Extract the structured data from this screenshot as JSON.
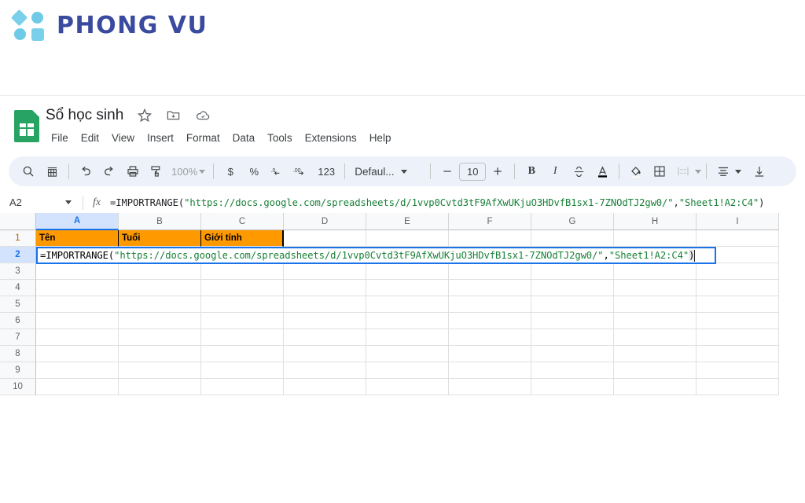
{
  "brand": {
    "name": "PHONG VU",
    "logo_icon": "phong-vu-squares-logo",
    "accent_light": "#7ACFEA",
    "accent_dark": "#3A4A9F"
  },
  "app": {
    "doc_title": "Sổ học sinh",
    "doc_icon": "google-sheets-icon",
    "title_actions": [
      {
        "icon": "star-icon",
        "name": "star-document"
      },
      {
        "icon": "move-folder-icon",
        "name": "move-to-folder"
      },
      {
        "icon": "cloud-icon",
        "name": "document-status-cloud"
      }
    ],
    "menus": [
      "File",
      "Edit",
      "View",
      "Insert",
      "Format",
      "Data",
      "Tools",
      "Extensions",
      "Help"
    ]
  },
  "toolbar": {
    "zoom_level": "100%",
    "font_name": "Defaul...",
    "font_size": "10",
    "number_format_label": "123",
    "currency_label": "$",
    "percent_label": "%",
    "decrease_decimal_label": ".0",
    "increase_decimal_label": ".00",
    "bold_label": "B",
    "italic_label": "I",
    "items": [
      {
        "name": "search-icon",
        "label": ""
      },
      {
        "name": "menus-history-icon",
        "label": ""
      },
      {
        "name": "undo-icon",
        "label": ""
      },
      {
        "name": "redo-icon",
        "label": ""
      },
      {
        "name": "print-icon",
        "label": ""
      },
      {
        "name": "paint-format-icon",
        "label": ""
      },
      {
        "name": "strikethrough-icon",
        "label": ""
      },
      {
        "name": "text-color-icon",
        "label": ""
      },
      {
        "name": "fill-color-icon",
        "label": ""
      },
      {
        "name": "borders-icon",
        "label": ""
      },
      {
        "name": "merge-cells-icon",
        "label": ""
      },
      {
        "name": "horizontal-align-icon",
        "label": ""
      },
      {
        "name": "vertical-align-icon",
        "label": ""
      }
    ]
  },
  "formula_bar": {
    "name_box": "A2",
    "fx_label": "fx",
    "formula_prefix": "=IMPORTRANGE(",
    "formula_url": "\"https://docs.google.com/spreadsheets/d/1vvp0Cvtd3tF9AfXwUKjuO3HDvfB1sx1-7ZNOdTJ2gw0/\"",
    "formula_mid": ",",
    "formula_range": "\"Sheet1!A2:C4\"",
    "formula_suffix": ")",
    "formula_full": "=IMPORTRANGE(\"https://docs.google.com/spreadsheets/d/1vvp0Cvtd3tF9AfXwUKjuO3HDvfB1sx1-7ZNOdTJ2gw0/\",\"Sheet1!A2:C4\")"
  },
  "grid": {
    "columns": [
      "A",
      "B",
      "C",
      "D",
      "E",
      "F",
      "G",
      "H",
      "I"
    ],
    "selected_column": "A",
    "selected_row": "2",
    "rows": [
      "1",
      "2",
      "3",
      "4",
      "5",
      "6",
      "7",
      "8",
      "9",
      "10"
    ],
    "header_row": {
      "fill_color": "#FF9900",
      "cells": [
        "Tên",
        "Tuổi",
        "Giới tính"
      ]
    },
    "active_cell": "A2",
    "active_cell_content": "=IMPORTRANGE(\"https://docs.google.com/spreadsheets/d/1vvp0Cvtd3tF9AfXwUKjuO3HDvfB1sx1-7ZNOdTJ2gw0/\",\"Sheet1!A2:C4\")"
  }
}
